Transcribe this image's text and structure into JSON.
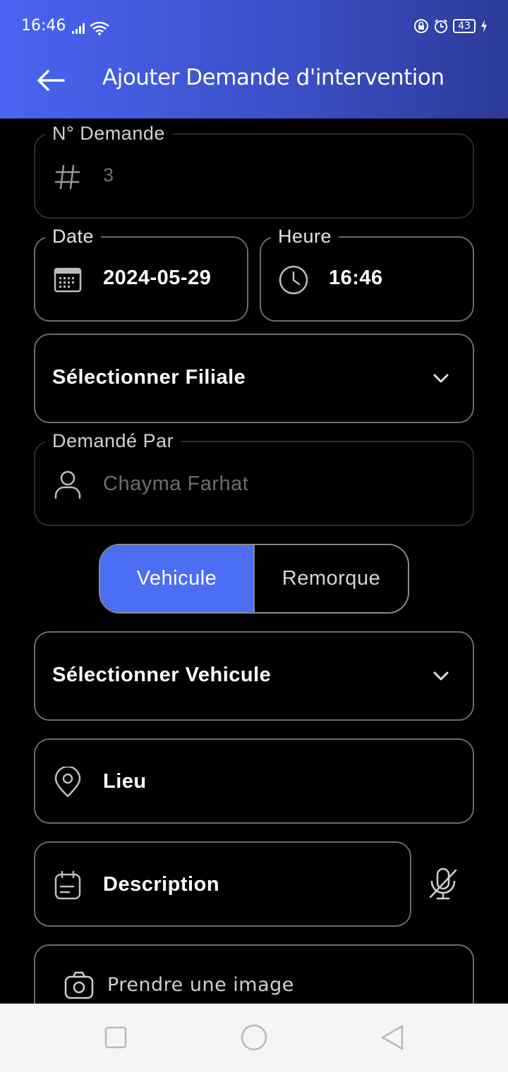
{
  "status_bar": {
    "time": "16:46",
    "battery": "43"
  },
  "appbar": {
    "title": "Ajouter Demande d'intervention"
  },
  "form": {
    "numero": {
      "label": "N° Demande",
      "value": "3"
    },
    "date": {
      "label": "Date",
      "value": "2024-05-29"
    },
    "heure": {
      "label": "Heure",
      "value": "16:46"
    },
    "filiale": {
      "text": "Sélectionner Filiale"
    },
    "demande_par": {
      "label": "Demandé Par",
      "value": "Chayma Farhat"
    },
    "segment": {
      "options": [
        "Vehicule",
        "Remorque"
      ],
      "selected": "Vehicule"
    },
    "vehicule": {
      "text": "Sélectionner Vehicule"
    },
    "lieu": {
      "placeholder": "Lieu"
    },
    "description": {
      "placeholder": "Description"
    },
    "image": {
      "text": "Prendre une image"
    }
  },
  "colors": {
    "accent": "#4c6ef5",
    "appbar_start": "#4a64f2",
    "appbar_end": "#2c3a98",
    "background": "#000000"
  },
  "icons": [
    "back-arrow-icon",
    "hash-icon",
    "calendar-icon",
    "clock-icon",
    "chevron-down-icon",
    "person-icon",
    "location-pin-icon",
    "note-icon",
    "mic-off-icon",
    "camera-icon"
  ]
}
